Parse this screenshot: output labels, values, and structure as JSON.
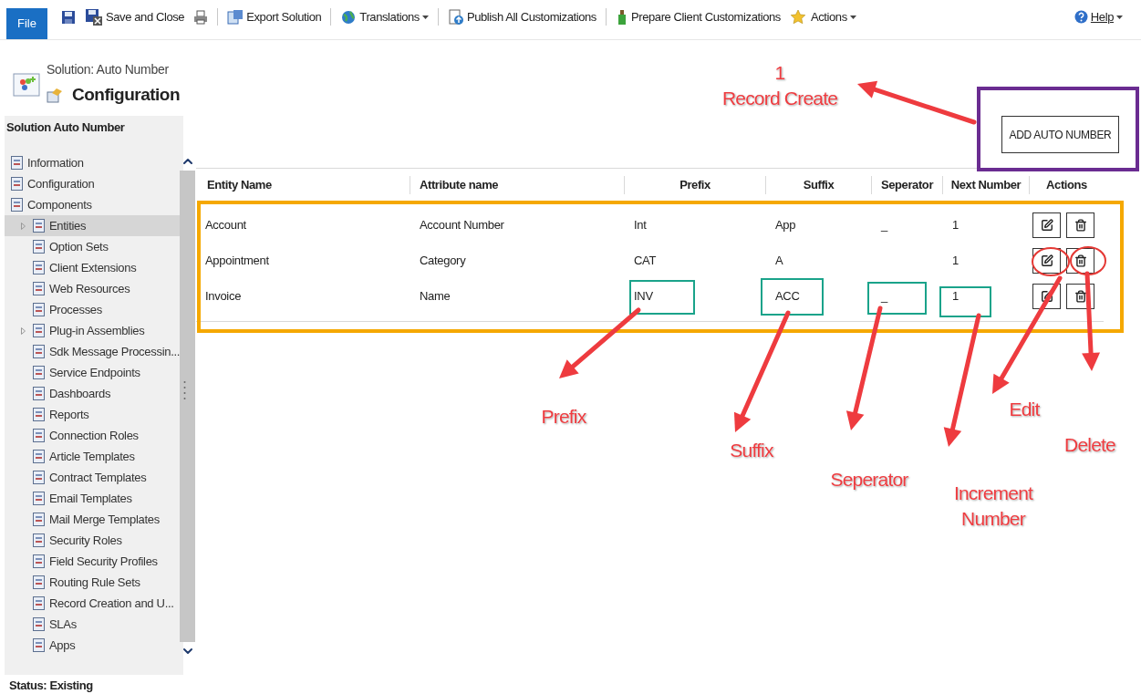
{
  "file_button": "File",
  "toolbar": [
    {
      "kind": "icon",
      "dropdown": false,
      "separator_before": false
    },
    {
      "kind": "text",
      "label": "Save and Close",
      "dropdown": false,
      "separator_before": false
    },
    {
      "kind": "icon",
      "dropdown": false,
      "separator_before": false
    },
    {
      "kind": "text",
      "label": "Export Solution",
      "dropdown": false,
      "separator_before": true
    },
    {
      "kind": "text",
      "label": "Translations",
      "dropdown": true,
      "separator_before": true
    },
    {
      "kind": "text",
      "label": "Publish All Customizations",
      "dropdown": false,
      "separator_before": true
    },
    {
      "kind": "text",
      "label": "Prepare Client Customizations",
      "dropdown": false,
      "separator_before": true
    },
    {
      "kind": "text",
      "label": "Actions",
      "dropdown": true,
      "separator_before": false
    }
  ],
  "help": {
    "label": "Help",
    "dropdown": true
  },
  "header": {
    "subtitle": "Solution: Auto Number",
    "title": "Configuration"
  },
  "sidebar": {
    "title": "Solution Auto Number",
    "items": [
      {
        "label": "Information",
        "selected": false,
        "expander": false
      },
      {
        "label": "Configuration",
        "selected": false,
        "expander": false
      },
      {
        "label": "Components",
        "selected": false,
        "expander": false,
        "children": [
          {
            "label": "Entities",
            "selected": true,
            "expander": true
          },
          {
            "label": "Option Sets",
            "selected": false,
            "expander": false
          },
          {
            "label": "Client Extensions",
            "selected": false,
            "expander": false
          },
          {
            "label": "Web Resources",
            "selected": false,
            "expander": false
          },
          {
            "label": "Processes",
            "selected": false,
            "expander": false
          },
          {
            "label": "Plug-in Assemblies",
            "selected": false,
            "expander": true
          },
          {
            "label": "Sdk Message Processin...",
            "selected": false,
            "expander": false
          },
          {
            "label": "Service Endpoints",
            "selected": false,
            "expander": false
          },
          {
            "label": "Dashboards",
            "selected": false,
            "expander": false
          },
          {
            "label": "Reports",
            "selected": false,
            "expander": false
          },
          {
            "label": "Connection Roles",
            "selected": false,
            "expander": false
          },
          {
            "label": "Article Templates",
            "selected": false,
            "expander": false
          },
          {
            "label": "Contract Templates",
            "selected": false,
            "expander": false
          },
          {
            "label": "Email Templates",
            "selected": false,
            "expander": false
          },
          {
            "label": "Mail Merge Templates",
            "selected": false,
            "expander": false
          },
          {
            "label": "Security Roles",
            "selected": false,
            "expander": false
          },
          {
            "label": "Field Security Profiles",
            "selected": false,
            "expander": false
          },
          {
            "label": "Routing Rule Sets",
            "selected": false,
            "expander": false
          },
          {
            "label": "Record Creation and U...",
            "selected": false,
            "expander": false
          },
          {
            "label": "SLAs",
            "selected": false,
            "expander": false
          },
          {
            "label": "Apps",
            "selected": false,
            "expander": false
          }
        ]
      }
    ]
  },
  "status_bar": "Status: Existing",
  "add_button": "ADD AUTO NUMBER",
  "table": {
    "columns": [
      "Entity Name",
      "Attribute name",
      "Prefix",
      "Suffix",
      "Seperator",
      "Next Number",
      "Actions"
    ],
    "rows": [
      {
        "cells": [
          "Account",
          "Account Number",
          "Int",
          "App",
          "_",
          "1"
        ]
      },
      {
        "cells": [
          "Appointment",
          "Category",
          "CAT",
          "A",
          "",
          "1"
        ]
      },
      {
        "cells": [
          "Invoice",
          "Name",
          "INV",
          "ACC",
          "_",
          "1"
        ]
      }
    ]
  },
  "annotations": [
    {
      "lines": [
        "1",
        "Record Create"
      ]
    },
    {
      "lines": [
        "Prefix"
      ]
    },
    {
      "lines": [
        "Edit"
      ]
    },
    {
      "lines": [
        "Delete"
      ]
    },
    {
      "lines": [
        "Suffix"
      ]
    },
    {
      "lines": [
        "Seperator"
      ]
    },
    {
      "lines": [
        "Increment",
        "Number"
      ]
    }
  ]
}
